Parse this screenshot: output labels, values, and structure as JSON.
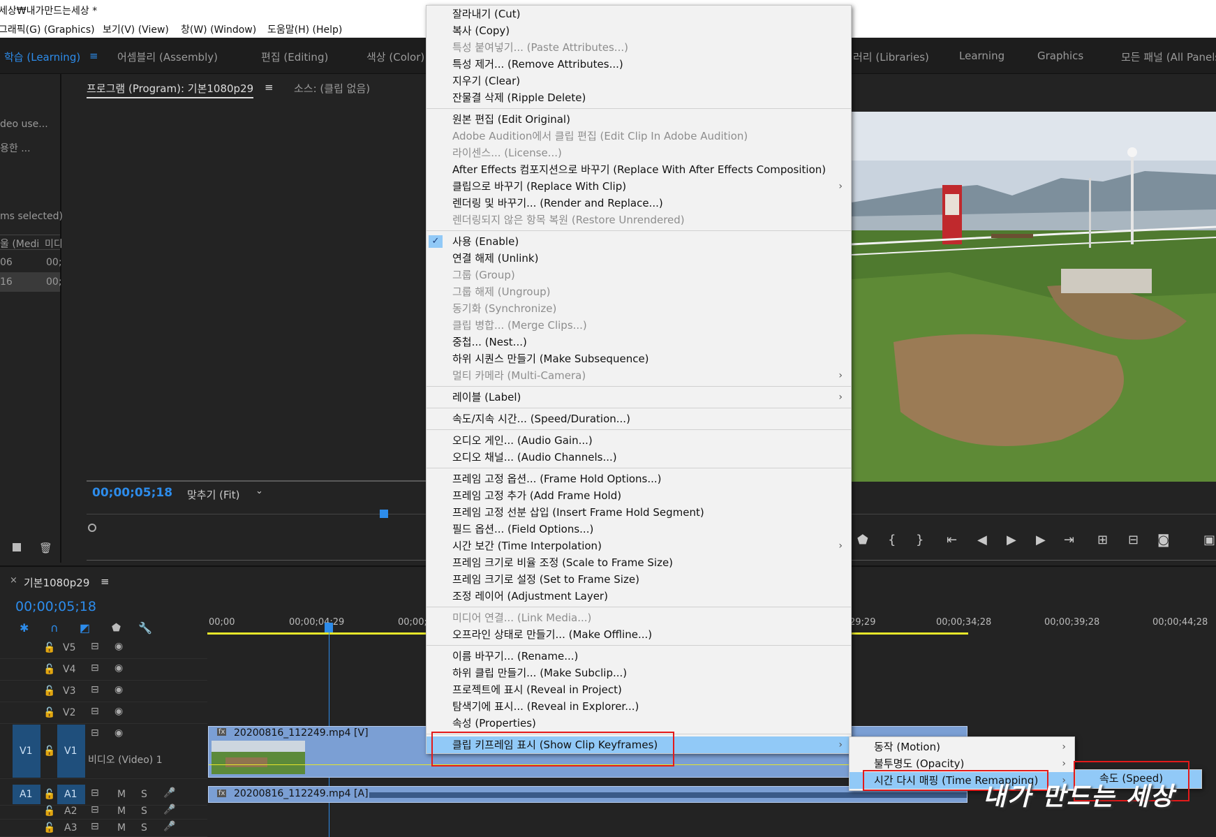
{
  "window": {
    "title": "세상₩내가만드는세상 *"
  },
  "menubar": [
    "그래픽(G) (Graphics)",
    "보기(V) (View)",
    "창(W) (Window)",
    "도움말(H) (Help)"
  ],
  "workspaces": {
    "left": [
      "학습 (Learning)",
      "어셈블리 (Assembly)",
      "편집 (Editing)",
      "색상 (Color)"
    ],
    "right": [
      "러리 (Libraries)",
      "Learning",
      "Graphics",
      "모든 패널 (All Panels)"
    ],
    "menu_icon": "≡"
  },
  "left_panel": {
    "row1": "deo use...",
    "row2": "용한 ...",
    "row3": "ms selected)",
    "col1": "울 (Medi",
    "col2": "미디",
    "r1c1": "06",
    "r1c2": "00;",
    "r2c1": "16",
    "r2c2": "00;"
  },
  "monitor": {
    "tab_program": "프로그램 (Program): 기본1080p29",
    "tab_source": "소스: (클립 없음)",
    "menu_icon": "≡",
    "timecode": "00;00;05;18",
    "fit": "맞추기 (Fit)"
  },
  "timeline": {
    "tab": "기본1080p29",
    "close": "×",
    "menu_icon": "≡",
    "timecode": "00;00;05;18",
    "ruler": [
      "00;00",
      "00;00;04;29",
      "00;00;",
      "29;29",
      "00;00;34;28",
      "00;00;39;28",
      "00;00;44;28"
    ],
    "tracks": [
      {
        "name": "V5"
      },
      {
        "name": "V4"
      },
      {
        "name": "V3"
      },
      {
        "name": "V2"
      },
      {
        "name": "V1",
        "src": "V1",
        "label": "비디오 (Video) 1"
      },
      {
        "name": "A1",
        "src": "A1"
      },
      {
        "name": "A2"
      },
      {
        "name": "A3"
      }
    ],
    "mute": "M",
    "solo": "S",
    "video_clip": "20200816_112249.mp4 [V]",
    "audio_clip": "20200816_112249.mp4 [A]",
    "fx": "fx"
  },
  "context_menu": {
    "groups": [
      [
        {
          "label": "잘라내기 (Cut)"
        },
        {
          "label": "복사 (Copy)"
        },
        {
          "label": "특성 붙여넣기... (Paste Attributes...)",
          "disabled": true
        },
        {
          "label": "특성 제거... (Remove Attributes...)"
        },
        {
          "label": "지우기 (Clear)"
        },
        {
          "label": "잔물결 삭제 (Ripple Delete)"
        }
      ],
      [
        {
          "label": "원본 편집 (Edit Original)"
        },
        {
          "label": "Adobe Audition에서 클립 편집 (Edit Clip In Adobe Audition)",
          "disabled": true
        },
        {
          "label": "라이센스... (License...)",
          "disabled": true
        },
        {
          "label": "After Effects 컴포지션으로 바꾸기 (Replace With After Effects Composition)"
        },
        {
          "label": "클립으로 바꾸기 (Replace With Clip)",
          "submenu": true
        },
        {
          "label": "렌더링 및 바꾸기... (Render and Replace...)"
        },
        {
          "label": "렌더링되지 않은 항목 복원 (Restore Unrendered)",
          "disabled": true
        }
      ],
      [
        {
          "label": "사용 (Enable)",
          "checked": true
        },
        {
          "label": "연결 해제 (Unlink)"
        },
        {
          "label": "그룹 (Group)",
          "disabled": true
        },
        {
          "label": "그룹 해제 (Ungroup)",
          "disabled": true
        },
        {
          "label": "동기화 (Synchronize)",
          "disabled": true
        },
        {
          "label": "클립 병합... (Merge Clips...)",
          "disabled": true
        },
        {
          "label": "중첩... (Nest...)"
        },
        {
          "label": "하위 시퀀스 만들기 (Make Subsequence)"
        },
        {
          "label": "멀티 카메라 (Multi-Camera)",
          "disabled": true,
          "submenu": true
        }
      ],
      [
        {
          "label": "레이블 (Label)",
          "submenu": true
        }
      ],
      [
        {
          "label": "속도/지속 시간... (Speed/Duration...)"
        }
      ],
      [
        {
          "label": "오디오 게인... (Audio Gain...)"
        },
        {
          "label": "오디오 채널... (Audio Channels...)"
        }
      ],
      [
        {
          "label": "프레임 고정 옵션... (Frame Hold Options...)"
        },
        {
          "label": "프레임 고정 추가 (Add Frame Hold)"
        },
        {
          "label": "프레임 고정 선분 삽입 (Insert Frame Hold Segment)"
        },
        {
          "label": "필드 옵션... (Field Options...)"
        },
        {
          "label": "시간 보간 (Time Interpolation)",
          "submenu": true
        },
        {
          "label": "프레임 크기로 비율 조정 (Scale to Frame Size)"
        },
        {
          "label": "프레임 크기로 설정 (Set to Frame Size)"
        },
        {
          "label": "조정 레이어 (Adjustment Layer)"
        }
      ],
      [
        {
          "label": "미디어 연결... (Link Media...)",
          "disabled": true
        },
        {
          "label": "오프라인 상태로 만들기... (Make Offline...)"
        }
      ],
      [
        {
          "label": "이름 바꾸기... (Rename...)"
        },
        {
          "label": "하위 클립 만들기... (Make Subclip...)"
        },
        {
          "label": "프로젝트에 표시 (Reveal in Project)"
        },
        {
          "label": "탐색기에 표시... (Reveal in Explorer...)"
        },
        {
          "label": "속성 (Properties)"
        }
      ],
      [
        {
          "label": "클립 키프레임 표시 (Show Clip Keyframes)",
          "submenu": true,
          "highlighted": true
        }
      ]
    ]
  },
  "keyframes_submenu": [
    {
      "label": "동작 (Motion)",
      "submenu": true
    },
    {
      "label": "불투명도 (Opacity)",
      "submenu": true
    },
    {
      "label": "시간 다시 매핑 (Time Remapping)",
      "submenu": true,
      "highlighted": true
    }
  ],
  "remap_submenu": [
    {
      "label": "속도 (Speed)",
      "highlighted": true
    }
  ],
  "watermark": "내가 만드는 세상",
  "colors": {
    "accent": "#2d8ceb",
    "highlight": "#91c9f7",
    "annotation": "#e31a1a",
    "clip": "#7b9fd4"
  }
}
